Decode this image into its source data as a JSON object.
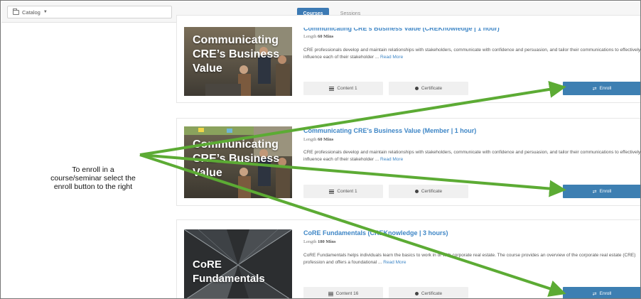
{
  "header": {
    "catalog_label": "Catalog",
    "tabs": [
      {
        "label": "Courses",
        "active": true
      },
      {
        "label": "Sessions",
        "active": false
      }
    ],
    "accent_color": "#3c7ab4"
  },
  "annotation": {
    "instruction_text": "To enroll in a course/seminar select the enroll button to the right",
    "arrow_color": "#5cab34"
  },
  "courses": [
    {
      "thumb_text": "Communicating CRE’s Business Value",
      "thumb_icon": "business-people-photo",
      "title": "Communicating CRE's Business Value (CREKnowledge | 1 hour)",
      "length_label": "Length",
      "length_value": "60 Mins",
      "description": "CRE professionals develop and maintain relationships with stakeholders, communicate with confidence and persuasion, and tailor their communications to effectively influence each of their stakeholder ...",
      "read_more": "Read More",
      "content_label": "Content 1",
      "certificate_label": "Certificate",
      "enroll_label": "Enroll"
    },
    {
      "thumb_text": "Communicating CRE’s Business Value",
      "thumb_icon": "business-people-photo",
      "title": "Communicating CRE's Business Value (Member | 1 hour)",
      "length_label": "Length",
      "length_value": "60 Mins",
      "description": "CRE professionals develop and maintain relationships with stakeholders, communicate with confidence and persuasion, and tailor their communications to effectively influence each of their stakeholder ...",
      "read_more": "Read More",
      "content_label": "Content 1",
      "certificate_label": "Certificate",
      "enroll_label": "Enroll"
    },
    {
      "thumb_text": "CoRE Fundamentals",
      "thumb_icon": "skyscrapers-photo",
      "title": "CoRE Fundamentals (CREKnowledge | 3 hours)",
      "length_label": "Length",
      "length_value": "180 Mins",
      "description": "CoRE Fundamentals helps individuals learn the basics to work in or with corporate real estate. The course provides an overview of the corporate real estate (CRE) profession and offers a foundational ...",
      "read_more": "Read More",
      "content_label": "Content 16",
      "certificate_label": "Certificate",
      "enroll_label": "Enroll"
    }
  ]
}
